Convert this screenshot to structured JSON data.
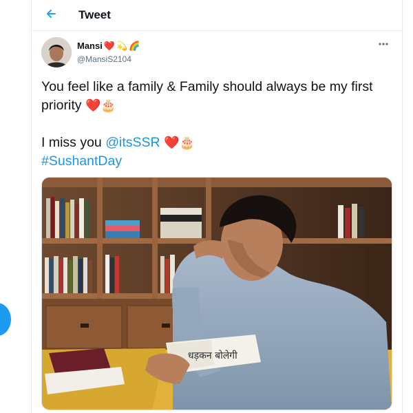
{
  "header": {
    "title": "Tweet"
  },
  "tweet": {
    "display_name": "Mansi",
    "name_emojis": [
      "❤️",
      "💫",
      "🌈"
    ],
    "handle": "@MansiS2104",
    "line1": "You feel like a family & Family should always be my first priority",
    "line2_prefix": "I miss you",
    "mention": "@itsSSR",
    "hashtag": "#SushantDay",
    "emojis": {
      "heart": "❤️",
      "cake": "🎂"
    },
    "photo_book_text": "धड़कन बोलेगी"
  },
  "icons": {
    "back": "back-arrow-icon",
    "more": "more-horizontal-icon"
  },
  "colors": {
    "accent": "#1da1f2",
    "link": "#1b95e0",
    "secondary_text": "#5b7083",
    "border": "#e6ecf0"
  }
}
